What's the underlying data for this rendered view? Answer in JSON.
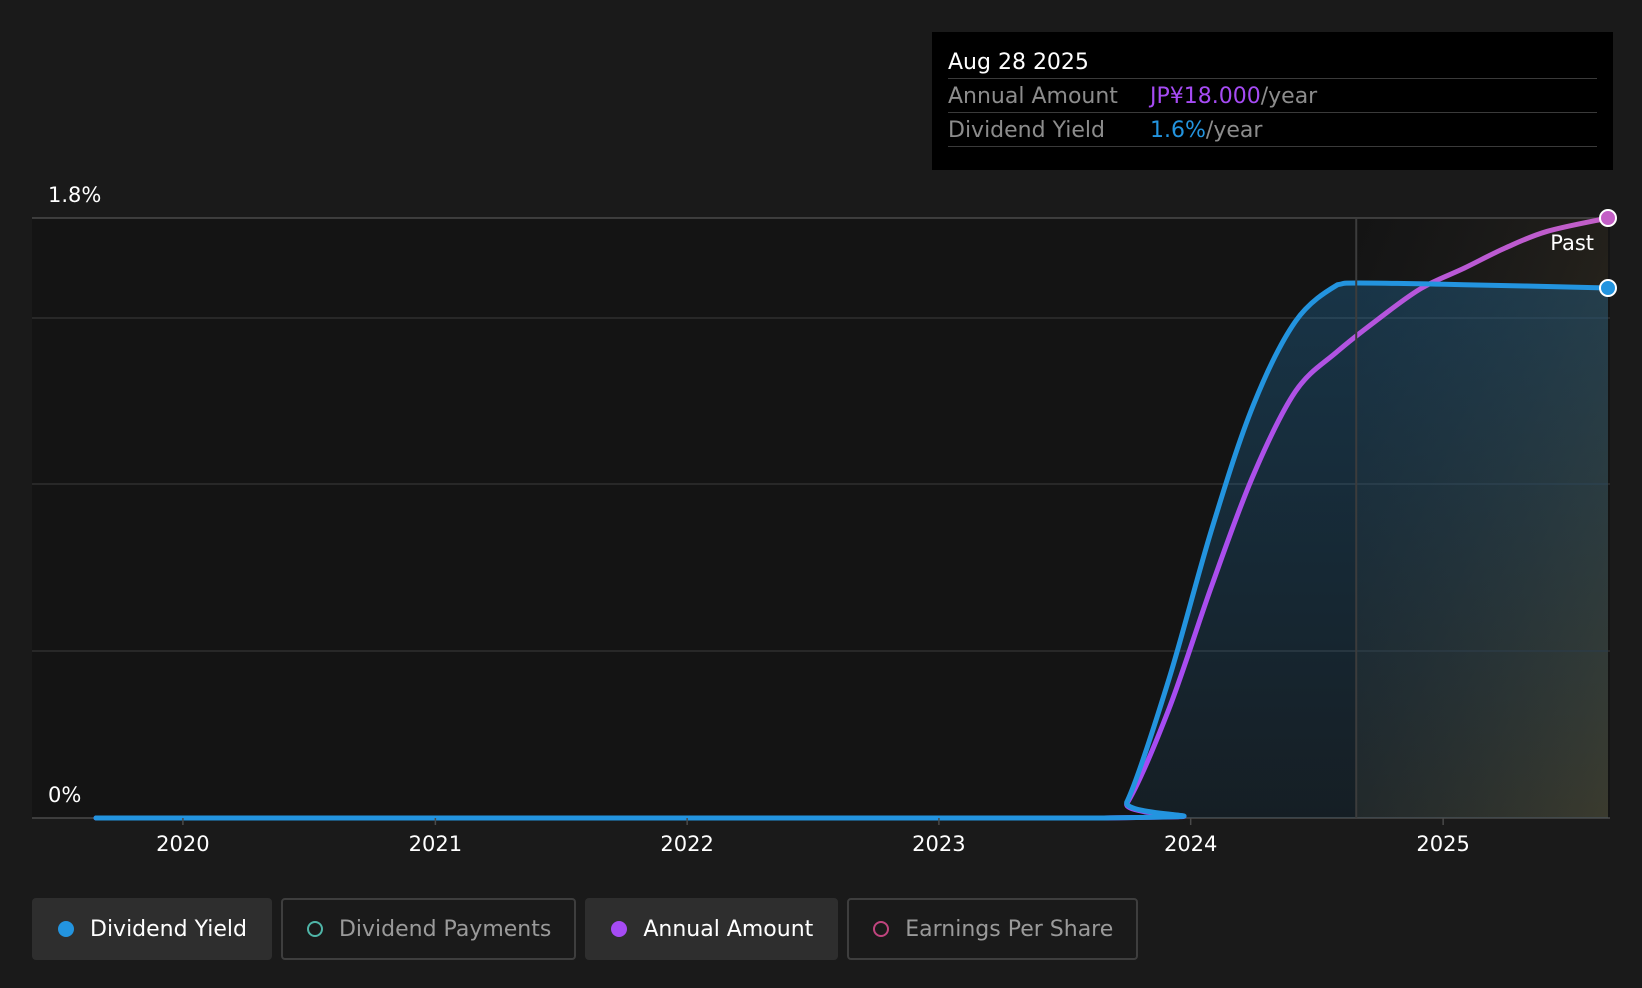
{
  "tooltip": {
    "date": "Aug 28 2025",
    "annual_amount_label": "Annual Amount",
    "annual_amount_value": "JP¥18.000",
    "dividend_yield_label": "Dividend Yield",
    "dividend_yield_value": "1.6%",
    "per_year": "/year"
  },
  "legend": [
    {
      "label": "Dividend Yield",
      "active": true,
      "filled": true,
      "color": "#2394df"
    },
    {
      "label": "Dividend Payments",
      "active": false,
      "filled": false,
      "color": "#4fb5a8"
    },
    {
      "label": "Annual Amount",
      "active": true,
      "filled": true,
      "color": "#a64bf4"
    },
    {
      "label": "Earnings Per Share",
      "active": false,
      "filled": false,
      "color": "#c0447e"
    }
  ],
  "colors": {
    "yield": "#2394df",
    "annual_amount": "#a64bf4",
    "annual_amount_end": "#c35fc6",
    "past_region": "#3d3424",
    "background": "#1a1a1a"
  },
  "chart_data": {
    "type": "line",
    "y_axis_labels": [
      "1.8%",
      "0%"
    ],
    "ylim": [
      0,
      1.8
    ],
    "x_ticks": [
      "2020",
      "2021",
      "2022",
      "2023",
      "2024",
      "2025"
    ],
    "xlim": [
      "2019-08-28",
      "2025-08-28"
    ],
    "past_label": "Past",
    "past_start": "2024-08-28",
    "grid": true,
    "series": [
      {
        "name": "Dividend Yield",
        "unit": "%",
        "points": [
          [
            "2019-08-28",
            0
          ],
          [
            "2023-08-28",
            0
          ],
          [
            "2023-10-01",
            0.05
          ],
          [
            "2023-12-01",
            0.42
          ],
          [
            "2024-02-01",
            0.87
          ],
          [
            "2024-04-01",
            1.24
          ],
          [
            "2024-06-01",
            1.49
          ],
          [
            "2024-08-01",
            1.6
          ],
          [
            "2024-09-01",
            1.605
          ],
          [
            "2025-02-01",
            1.6
          ],
          [
            "2025-08-28",
            1.59
          ]
        ]
      },
      {
        "name": "Annual Amount",
        "unit": "JP¥",
        "points": [
          [
            "2019-08-28",
            0
          ],
          [
            "2023-08-28",
            0
          ],
          [
            "2023-10-01",
            0.45
          ],
          [
            "2023-12-01",
            3.3
          ],
          [
            "2024-02-01",
            7.0
          ],
          [
            "2024-04-01",
            10.3
          ],
          [
            "2024-06-01",
            12.8
          ],
          [
            "2024-08-01",
            14.0
          ],
          [
            "2024-10-01",
            15.0
          ],
          [
            "2024-12-01",
            15.9
          ],
          [
            "2025-02-01",
            16.5
          ],
          [
            "2025-04-01",
            17.1
          ],
          [
            "2025-06-01",
            17.6
          ],
          [
            "2025-08-28",
            18.0
          ]
        ]
      }
    ]
  }
}
